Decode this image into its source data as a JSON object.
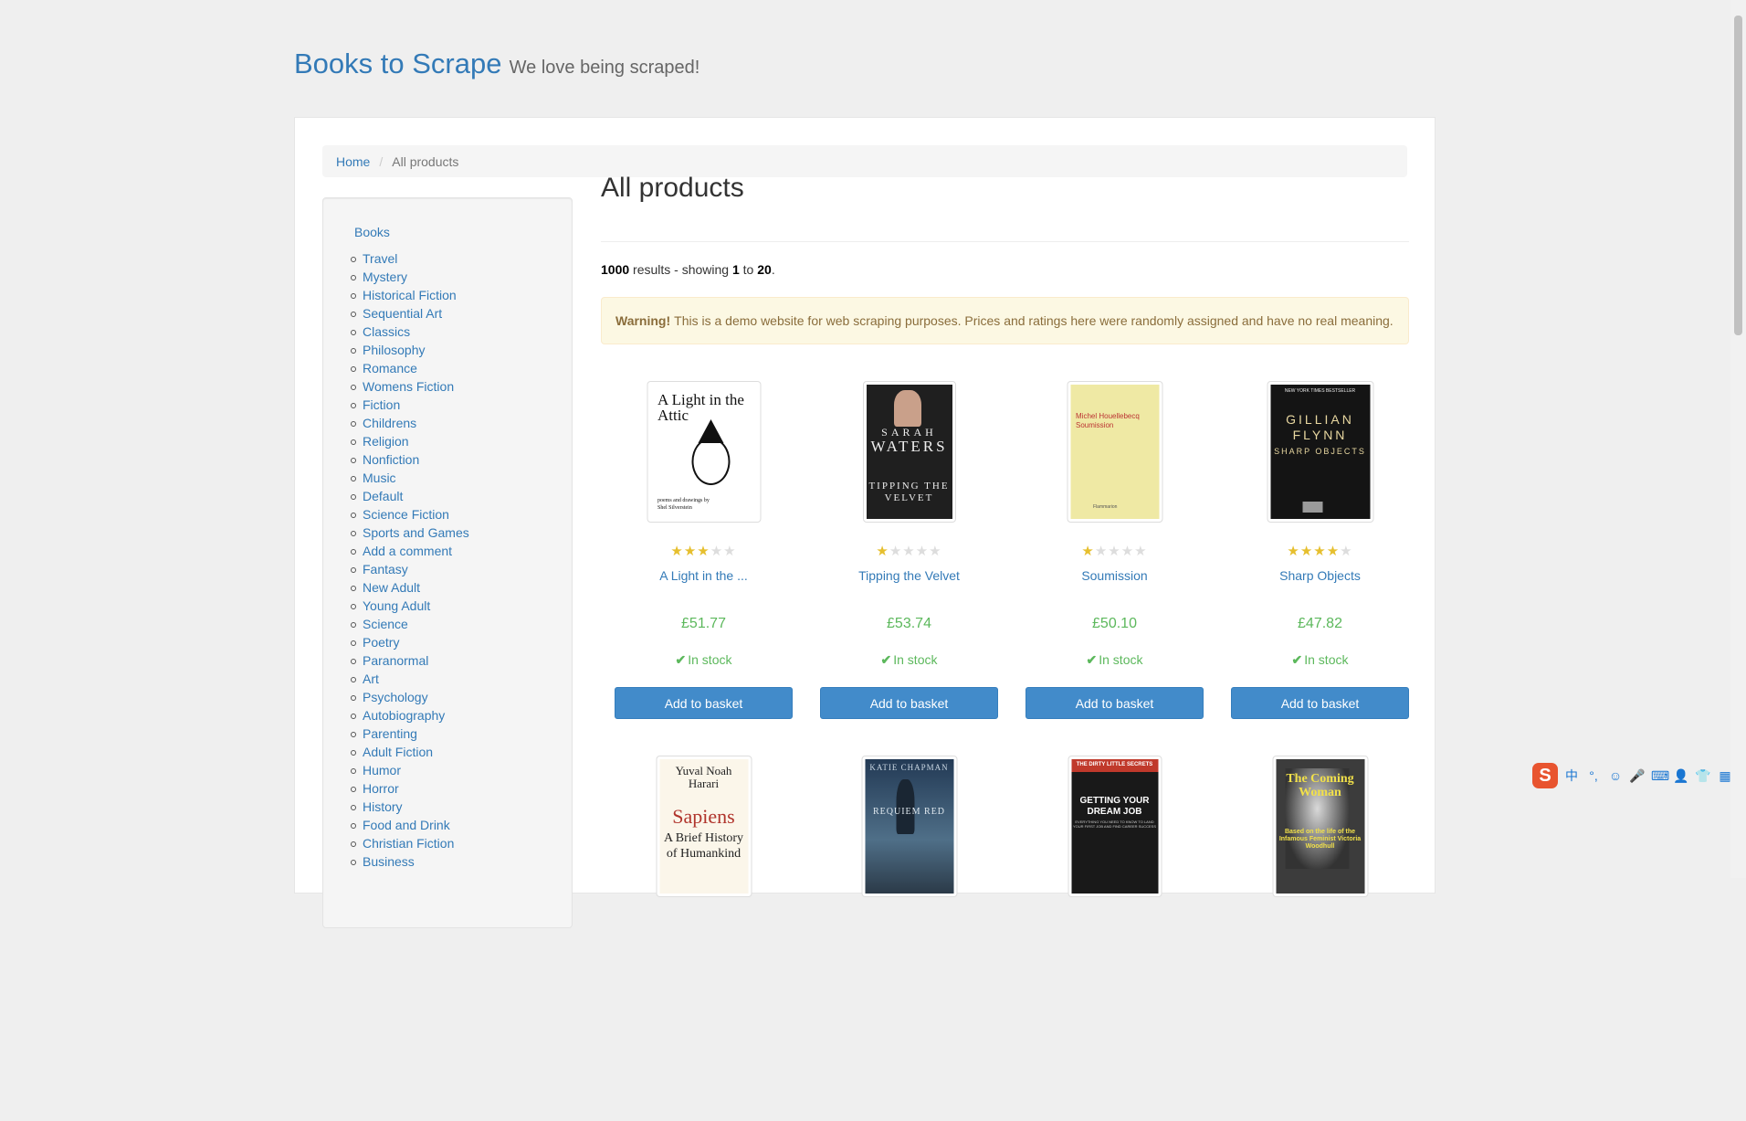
{
  "header": {
    "brand": "Books to Scrape",
    "tagline": "We love being scraped!"
  },
  "breadcrumb": {
    "home": "Home",
    "current": "All products"
  },
  "sidebar": {
    "title": "Books",
    "categories": [
      "Travel",
      "Mystery",
      "Historical Fiction",
      "Sequential Art",
      "Classics",
      "Philosophy",
      "Romance",
      "Womens Fiction",
      "Fiction",
      "Childrens",
      "Religion",
      "Nonfiction",
      "Music",
      "Default",
      "Science Fiction",
      "Sports and Games",
      "Add a comment",
      "Fantasy",
      "New Adult",
      "Young Adult",
      "Science",
      "Poetry",
      "Paranormal",
      "Art",
      "Psychology",
      "Autobiography",
      "Parenting",
      "Adult Fiction",
      "Humor",
      "Horror",
      "History",
      "Food and Drink",
      "Christian Fiction",
      "Business"
    ]
  },
  "main": {
    "title": "All products",
    "results": {
      "total": "1000",
      "text1": " results - showing ",
      "from": "1",
      "text2": " to ",
      "to": "20",
      "end": "."
    },
    "alert": {
      "strong": "Warning!",
      "text": "This is a demo website for web scraping purposes. Prices and ratings here were randomly assigned and have no real meaning."
    }
  },
  "products": [
    {
      "name": "A Light in the ...",
      "price": "£51.77",
      "rating": 3,
      "stock": "In stock",
      "button": "Add to basket",
      "cover": {
        "title": "A Light in the Attic",
        "byline": "poems and drawings by",
        "author": "Shel Silverstein"
      }
    },
    {
      "name": "Tipping the Velvet",
      "price": "£53.74",
      "rating": 1,
      "stock": "In stock",
      "button": "Add to basket",
      "cover": {
        "author1": "SARAH",
        "author2": "WATERS",
        "title": "TIPPING THE VELVET"
      }
    },
    {
      "name": "Soumission",
      "price": "£50.10",
      "rating": 1,
      "stock": "In stock",
      "button": "Add to basket",
      "cover": {
        "author": "Michel Houellebecq",
        "title": "Soumission",
        "publisher": "Flammarion"
      }
    },
    {
      "name": "Sharp Objects",
      "price": "£47.82",
      "rating": 4,
      "stock": "In stock",
      "button": "Add to basket",
      "cover": {
        "top": "NEW YORK TIMES BESTSELLER",
        "author": "GILLIAN FLYNN",
        "title": "SHARP OBJECTS"
      }
    },
    {
      "cover": {
        "author": "Yuval Noah Harari",
        "title": "Sapiens",
        "subtitle": "A Brief History of Humankind"
      }
    },
    {
      "cover": {
        "author": "KATIE CHAPMAN",
        "title": "REQUIEM RED"
      }
    },
    {
      "cover": {
        "top": "THE DIRTY LITTLE SECRETS",
        "title": "GETTING YOUR DREAM JOB",
        "sub": "EVERYTHING YOU NEED TO KNOW TO LAND YOUR FIRST JOB AND FIND CAREER SUCCESS"
      }
    },
    {
      "cover": {
        "title": "The Coming Woman",
        "sub": "Based on the life of the Infamous Feminist Victoria Woodhull"
      }
    }
  ],
  "ime": {
    "logo": "S",
    "lang": "中"
  },
  "colors": {
    "link": "#337ab7",
    "price": "#5cb85c",
    "star": "#e6bf2e",
    "button": "#428bca"
  }
}
